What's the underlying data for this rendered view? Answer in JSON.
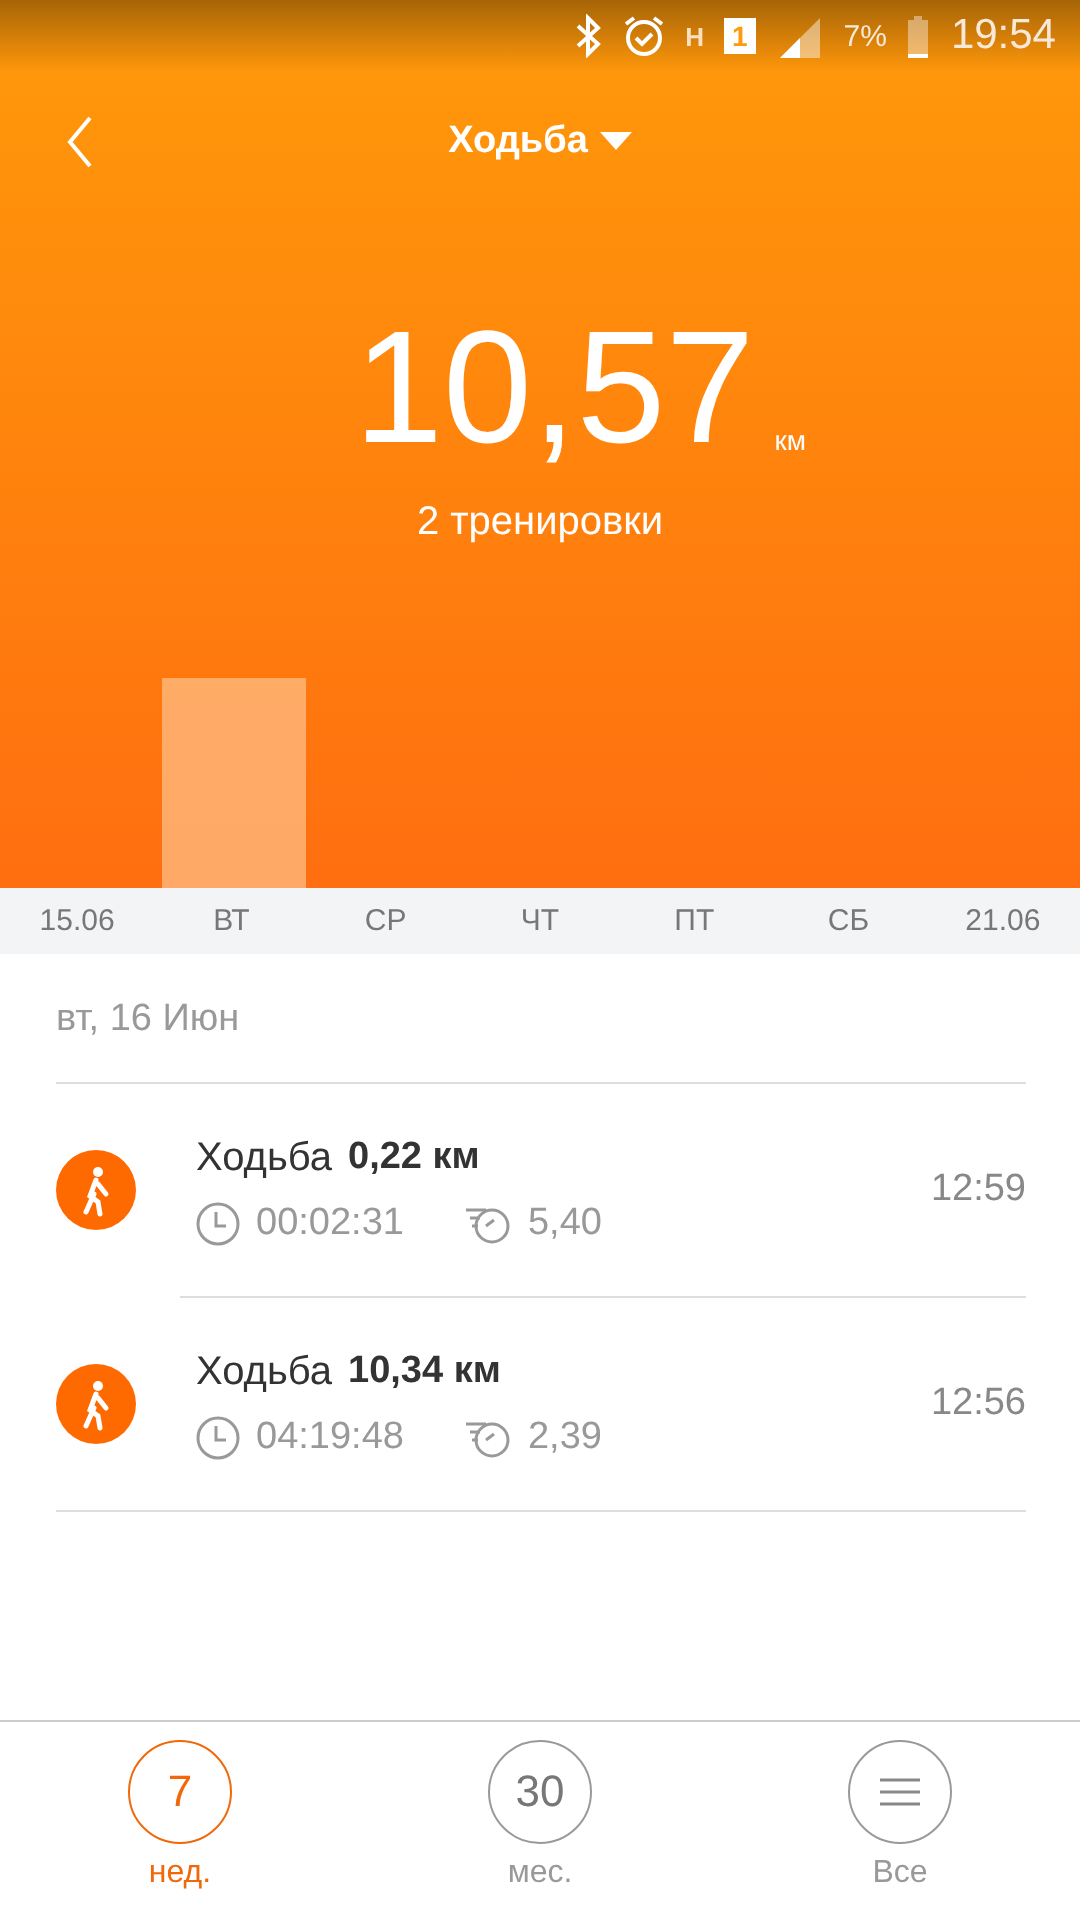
{
  "status_bar": {
    "battery": "7%",
    "time": "19:54",
    "network": "H",
    "sim": "1"
  },
  "header": {
    "title": "Ходьба",
    "total": "10,57",
    "unit": "км",
    "workouts": "2 тренировки"
  },
  "days": [
    {
      "label": "15.06",
      "has_workout": false
    },
    {
      "label": "ВТ",
      "has_workout": true
    },
    {
      "label": "СР",
      "has_workout": false
    },
    {
      "label": "ЧТ",
      "has_workout": false
    },
    {
      "label": "ПТ",
      "has_workout": false
    },
    {
      "label": "СБ",
      "has_workout": false
    },
    {
      "label": "21.06",
      "has_workout": false
    }
  ],
  "date_header": "вт, 16 Июн",
  "workouts": [
    {
      "name": "Ходьба",
      "distance": "0,22 км",
      "duration": "00:02:31",
      "pace": "5,40",
      "time": "12:59"
    },
    {
      "name": "Ходьба",
      "distance": "10,34 км",
      "duration": "04:19:48",
      "pace": "2,39",
      "time": "12:56"
    }
  ],
  "bottom_nav": [
    {
      "kind": "number",
      "value": "7",
      "label": "нед.",
      "selected": true
    },
    {
      "kind": "number",
      "value": "30",
      "label": "мес.",
      "selected": false
    },
    {
      "kind": "menu",
      "label": "Все",
      "selected": false
    }
  ]
}
